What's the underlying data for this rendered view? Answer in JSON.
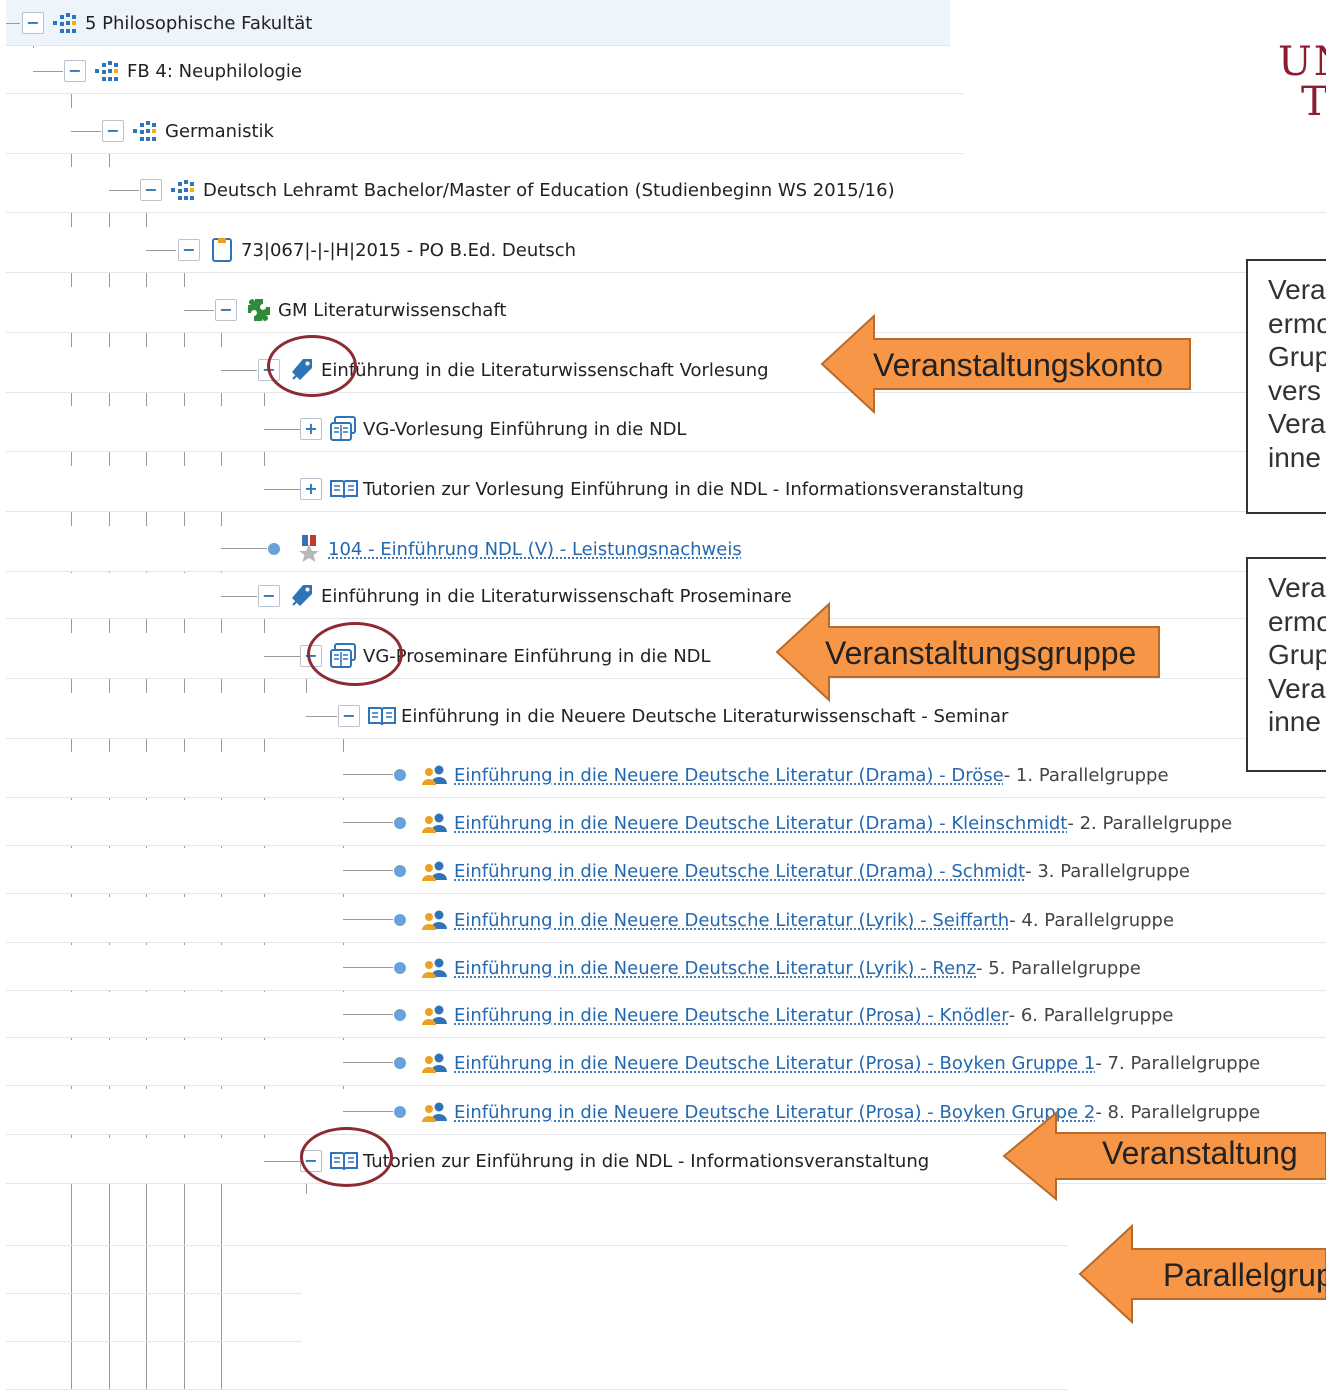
{
  "tree": {
    "rows": [
      {
        "label": "5 Philosophische Fakultät"
      },
      {
        "label": "FB 4: Neuphilologie"
      },
      {
        "label": "Germanistik"
      },
      {
        "label": "Deutsch Lehramt Bachelor/Master of Education (Studienbeginn WS 2015/16)"
      },
      {
        "label": "73|067|-|-|H|2015 - PO B.Ed. Deutsch"
      },
      {
        "label": "GM Literaturwissenschaft"
      },
      {
        "label": "Einführung in die Literaturwissenschaft Vorlesung"
      },
      {
        "label": "VG-Vorlesung Einführung in die NDL"
      },
      {
        "label": "Tutorien zur Vorlesung Einführung in die NDL - Informationsveranstaltung"
      },
      {
        "label": "104 - Einführung NDL (V) - Leistungsnachweis"
      },
      {
        "label": "Einführung in die Literaturwissenschaft Proseminare"
      },
      {
        "label": "VG-Proseminare Einführung in die NDL"
      },
      {
        "label": "Einführung in die Neuere Deutsche Literaturwissenschaft - Seminar"
      },
      {
        "label": "Einführung in die Neuere Deutsche Literatur (Drama) - Dröse",
        "suffix": " - 1. Parallelgruppe"
      },
      {
        "label": "Einführung in die Neuere Deutsche Literatur (Drama) - Kleinschmidt",
        "suffix": " - 2. Parallelgruppe"
      },
      {
        "label": "Einführung in die Neuere Deutsche Literatur (Drama) - Schmidt",
        "suffix": " - 3. Parallelgruppe"
      },
      {
        "label": "Einführung in die Neuere Deutsche Literatur (Lyrik) - Seiffarth",
        "suffix": " - 4. Parallelgruppe"
      },
      {
        "label": "Einführung in die Neuere Deutsche Literatur (Lyrik) - Renz",
        "suffix": " - 5. Parallelgruppe"
      },
      {
        "label": "Einführung in die Neuere Deutsche Literatur (Prosa) - Knödler",
        "suffix": " - 6. Parallelgruppe"
      },
      {
        "label": "Einführung in die Neuere Deutsche Literatur (Prosa) - Boyken Gruppe 1",
        "suffix": " - 7. Parallelgruppe"
      },
      {
        "label": "Einführung in die Neuere Deutsche Literatur (Prosa) - Boyken Gruppe 2",
        "suffix": " - 8. Parallelgruppe"
      },
      {
        "label": "Tutorien zur Einführung in die NDL - Informationsveranstaltung"
      }
    ]
  },
  "logo": {
    "line1": "UN",
    "line2": "T",
    "color": "#8e1b2e"
  },
  "annotations": {
    "box1": [
      "Vera",
      "ermo",
      "Grup",
      "vers",
      "Vera",
      "inne"
    ],
    "box2": [
      "Vera",
      "ermo",
      "Grup",
      "Vera",
      "inne"
    ]
  },
  "callouts": {
    "konto": "Veranstaltungskonto",
    "gruppe": "Veranstaltungsgruppe",
    "veranstaltung": "Veranstaltung",
    "parallelgruppe": "Parallelgrup"
  },
  "colors": {
    "arrow_fill": "#f79646",
    "arrow_stroke": "#b86a2a",
    "circle": "#8c2b33",
    "link": "#2368b0",
    "toggle": "#2f74b8"
  },
  "icons": {
    "org": "org-unit-icon",
    "po": "examination-regulation-icon",
    "module": "module-puzzle-icon",
    "konto": "course-account-tag-icon",
    "group": "course-group-icon",
    "course": "open-book-icon",
    "exam": "achievement-medal-icon",
    "parallel": "parallel-group-people-icon"
  }
}
